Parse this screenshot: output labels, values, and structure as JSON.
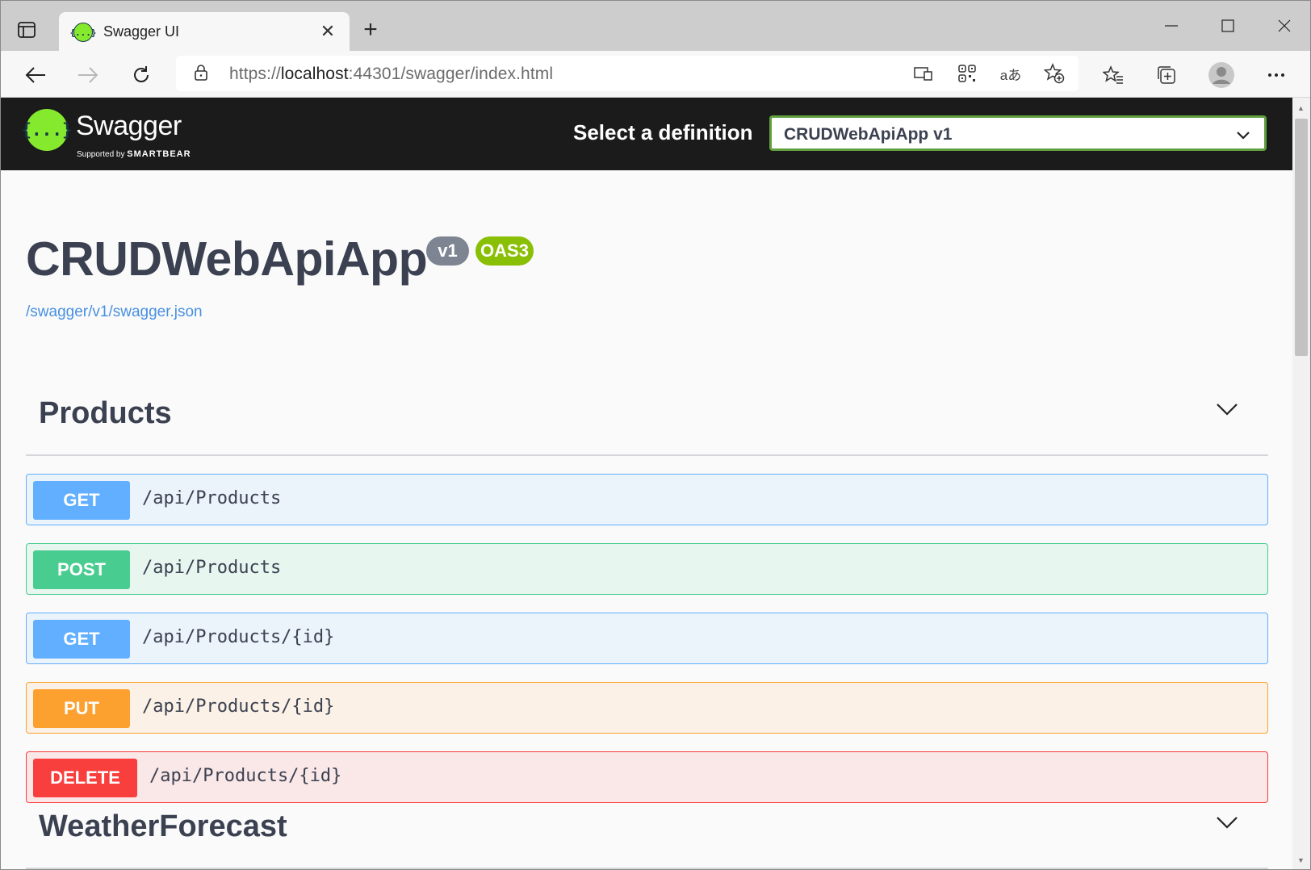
{
  "browser": {
    "tab_title": "Swagger UI",
    "tab_favicon_glyph": "{...}",
    "new_tab_glyph": "+",
    "close_glyph": "✕",
    "url_scheme": "https://",
    "url_host": "localhost",
    "url_rest": ":44301/swagger/index.html",
    "toolbar_icons": [
      "back-icon",
      "forward-icon",
      "refresh-icon",
      "lock-icon",
      "app-available-icon",
      "qr-code-icon",
      "translate-icon",
      "add-favorite-icon",
      "favorites-icon",
      "collections-icon",
      "profile-avatar",
      "more-icon"
    ],
    "translate_glyph": "aあ"
  },
  "topbar": {
    "logo_glyph": "{...}",
    "logo_text": "Swagger",
    "logo_sub_prefix": "Supported by",
    "logo_sub_brand": "SMARTBEAR",
    "definition_label": "Select a definition",
    "definition_value": "CRUDWebApiApp v1",
    "background": "#1b1b1b",
    "accent": "#85ea2d"
  },
  "info": {
    "title": "CRUDWebApiApp",
    "version_badge": "v1",
    "oas_badge": "OAS3",
    "spec_link": "/swagger/v1/swagger.json"
  },
  "tags": [
    {
      "name": "Products",
      "operations": [
        {
          "method": "GET",
          "path": "/api/Products"
        },
        {
          "method": "POST",
          "path": "/api/Products"
        },
        {
          "method": "GET",
          "path": "/api/Products/{id}"
        },
        {
          "method": "PUT",
          "path": "/api/Products/{id}"
        },
        {
          "method": "DELETE",
          "path": "/api/Products/{id}"
        }
      ]
    },
    {
      "name": "WeatherForecast",
      "operations": []
    }
  ],
  "method_colors": {
    "GET": "#61affe",
    "POST": "#49cc90",
    "PUT": "#fca130",
    "DELETE": "#f93e3e"
  }
}
